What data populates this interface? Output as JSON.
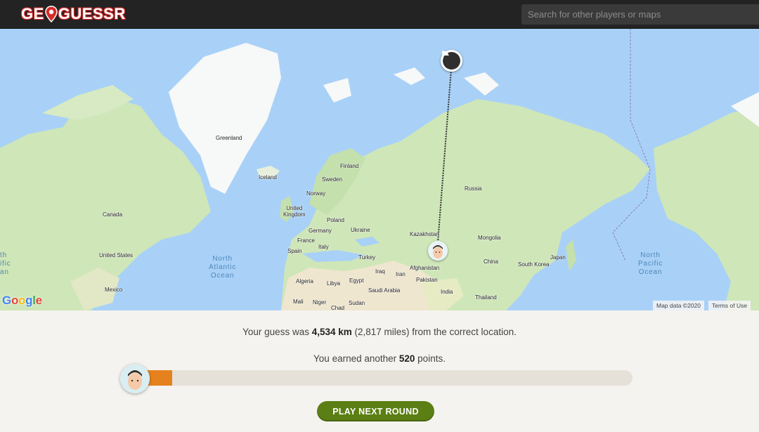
{
  "header": {
    "logo_left": "GE",
    "logo_right": "GUESSR",
    "search_placeholder": "Search for other players or maps"
  },
  "map": {
    "labels": {
      "greenland": "Greenland",
      "iceland": "Iceland",
      "finland": "Finland",
      "sweden": "Sweden",
      "norway": "Norway",
      "uk": "United\nKingdom",
      "poland": "Poland",
      "germany": "Germany",
      "ukraine": "Ukraine",
      "france": "France",
      "italy": "Italy",
      "spain": "Spain",
      "russia": "Russia",
      "kazakhstan": "Kazakhstan",
      "mongolia": "Mongolia",
      "china": "China",
      "south_korea": "South Korea",
      "japan": "Japan",
      "turkey": "Turkey",
      "iraq": "Iraq",
      "iran": "Iran",
      "afghanistan": "Afghanistan",
      "pakistan": "Pakistan",
      "india": "India",
      "thailand": "Thailand",
      "algeria": "Algeria",
      "libya": "Libya",
      "egypt": "Egypt",
      "saudi": "Saudi Arabia",
      "mali": "Mali",
      "niger": "Niger",
      "chad": "Chad",
      "sudan": "Sudan",
      "canada": "Canada",
      "us": "United States",
      "mexico": "Mexico"
    },
    "oceans": {
      "north_atlantic": "North\nAtlantic\nOcean",
      "north_pacific_right": "North\nPacific\nOcean",
      "north_pacific_left": "th\nific\nan"
    },
    "google_logo": "Google",
    "attribution_data": "Map data ©2020",
    "attribution_terms": "Terms of Use",
    "icons": {
      "correct_location": "flag-icon",
      "guess_location": "player-avatar-icon"
    },
    "colors": {
      "water": "#a9d1f7",
      "land": "#cfe6b8",
      "ice": "#f7f8f8",
      "desert": "#efe6cf",
      "line": "#333333"
    }
  },
  "result": {
    "line1_prefix": "Your guess was ",
    "distance_km": "4,534 km",
    "distance_miles": " (2,817 miles) from the correct location.",
    "line2_prefix": "You earned another ",
    "points": "520",
    "line2_suffix": " points.",
    "progress_fraction": 0.087,
    "progress_color": "#e6821e",
    "button_label": "PLAY NEXT ROUND",
    "button_color": "#5b7f14"
  }
}
